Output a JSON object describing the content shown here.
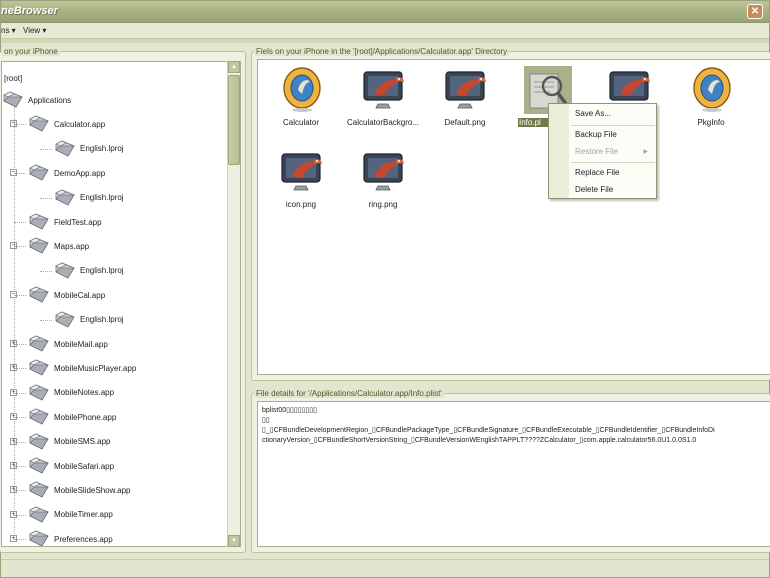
{
  "window": {
    "title": "neBrowser"
  },
  "menubar": {
    "items": [
      {
        "label": "ns ▾"
      },
      {
        "label": "View ▾"
      }
    ]
  },
  "left_panel": {
    "legend": "on your iPhone",
    "tree": [
      {
        "label": "[root]",
        "level": 0,
        "toggle": ""
      },
      {
        "label": "Applications",
        "level": 0,
        "toggle": ""
      },
      {
        "label": "Calculator.app",
        "level": 1,
        "toggle": "−"
      },
      {
        "label": "English.lproj",
        "level": 2,
        "toggle": ""
      },
      {
        "label": "DemoApp.app",
        "level": 1,
        "toggle": "−"
      },
      {
        "label": "English.lproj",
        "level": 2,
        "toggle": ""
      },
      {
        "label": "FieldTest.app",
        "level": 1,
        "toggle": ""
      },
      {
        "label": "Maps.app",
        "level": 1,
        "toggle": "−"
      },
      {
        "label": "English.lproj",
        "level": 2,
        "toggle": ""
      },
      {
        "label": "MobileCal.app",
        "level": 1,
        "toggle": "−"
      },
      {
        "label": "English.lproj",
        "level": 2,
        "toggle": ""
      },
      {
        "label": "MobileMail.app",
        "level": 1,
        "toggle": "+"
      },
      {
        "label": "MobileMusicPlayer.app",
        "level": 1,
        "toggle": "+"
      },
      {
        "label": "MobileNotes.app",
        "level": 1,
        "toggle": "+"
      },
      {
        "label": "MobilePhone.app",
        "level": 1,
        "toggle": "+"
      },
      {
        "label": "MobileSMS.app",
        "level": 1,
        "toggle": "+"
      },
      {
        "label": "MobileSafari.app",
        "level": 1,
        "toggle": "+"
      },
      {
        "label": "MobileSlideShow.app",
        "level": 1,
        "toggle": "+"
      },
      {
        "label": "MobileTimer.app",
        "level": 1,
        "toggle": "+"
      },
      {
        "label": "Preferences.app",
        "level": 1,
        "toggle": "+"
      }
    ]
  },
  "files_panel": {
    "legend": "Fiels on your iPhone in the '[root]/Applications/Calculator.app' Directory",
    "files": [
      {
        "label": "Calculator",
        "icon": "calculator-app-icon"
      },
      {
        "label": "CalculatorBackgro...",
        "icon": "monitor-parrot-icon"
      },
      {
        "label": "Default.png",
        "icon": "monitor-parrot-icon"
      },
      {
        "label": "Info.pl",
        "icon": "plist-magnifier-icon",
        "selected": true
      },
      {
        "label": "...g",
        "icon": "monitor-parrot-icon"
      },
      {
        "label": "PkgInfo",
        "icon": "calculator-app-icon"
      },
      {
        "label": "icon.png",
        "icon": "monitor-parrot-icon"
      },
      {
        "label": "ring.png",
        "icon": "monitor-parrot-icon"
      }
    ]
  },
  "context_menu": {
    "items": [
      {
        "label": "Save As...",
        "disabled": false
      },
      {
        "label": "Backup File",
        "disabled": false
      },
      {
        "label": "Restore File",
        "disabled": true
      },
      {
        "label": "Replace File",
        "disabled": false
      },
      {
        "label": "Delete File",
        "disabled": false
      }
    ]
  },
  "details_panel": {
    "legend": "File details for '/Applications/Calculator.app/Info.plist'",
    "lines": [
      "bplist00▯▯▯▯▯▯▯▯",
      "▯▯",
      "▯_▯CFBundleDevelopmentRegion_▯CFBundlePackageType_▯CFBundleSignature_▯CFBundleExecutable_▯CFBundleIdentifier_▯CFBundleInfoDi",
      "ctionaryVersion_▯CFBundleShortVersionString_▯CFBundleVersionWEnglishTAPPLT????ZCalculator_▯com.apple.calculator56.0U1.0.0S1.0"
    ]
  },
  "colors": {
    "title_bar": "#a7b07f",
    "accent": "#6f7b49",
    "panel_border": "#a9ae8e"
  }
}
